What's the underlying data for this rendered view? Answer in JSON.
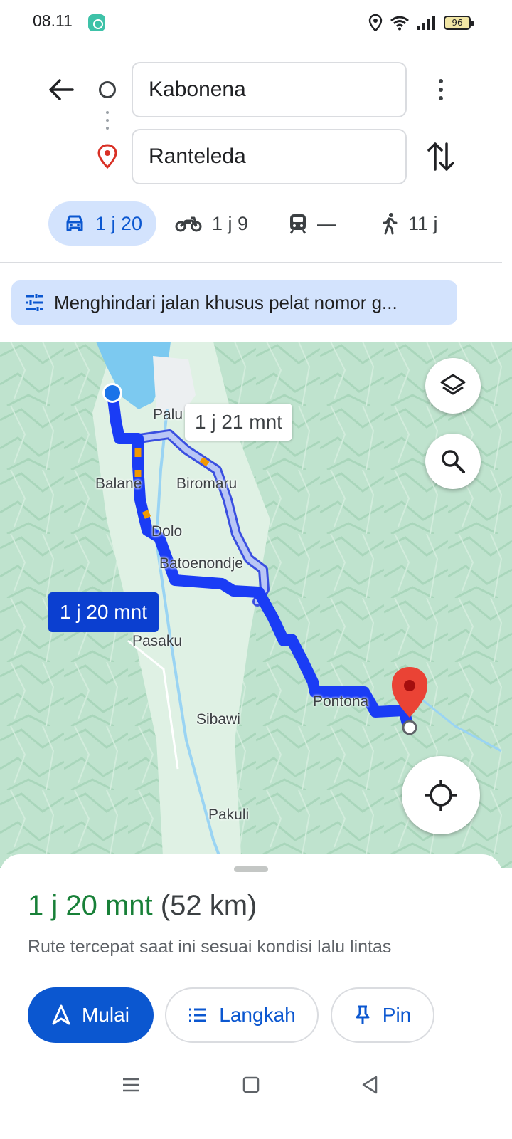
{
  "status_bar": {
    "time": "08.11",
    "battery": "96",
    "icons": [
      "location-icon",
      "wifi-icon",
      "signal-icon",
      "battery-icon"
    ]
  },
  "directions": {
    "from": "Kabonena",
    "to": "Ranteleda"
  },
  "modes": {
    "car": "1 j 20",
    "motorcycle": "1 j 9",
    "transit": "—",
    "walk": "11 j",
    "selected": "car"
  },
  "avoid_chip": {
    "label": "Menghindari jalan khusus pelat nomor g..."
  },
  "map": {
    "labels": {
      "palu": "Palu",
      "balane": "Balane",
      "biromaru": "Biromaru",
      "dolo": "Dolo",
      "batoenondje": "Batoenondje",
      "pasaku": "Pasaku",
      "sibawi": "Sibawi",
      "pontona": "Pontona",
      "pakuli": "Pakuli"
    },
    "alt_route_time": "1 j 21 mnt",
    "main_route_time": "1 j 20 mnt"
  },
  "sheet": {
    "duration": "1 j 20 mnt",
    "distance": "(52 km)",
    "subtitle": "Rute tercepat saat ini sesuai kondisi lalu lintas",
    "start_label": "Mulai",
    "steps_label": "Langkah",
    "pin_label": "Pin"
  },
  "colors": {
    "primary": "#0b57d0",
    "route": "#1a3cf5",
    "duration_green": "#188038",
    "chip_bg": "#d3e3fd",
    "map_bg": "#bfe3ce",
    "water": "#7cc9f0"
  }
}
